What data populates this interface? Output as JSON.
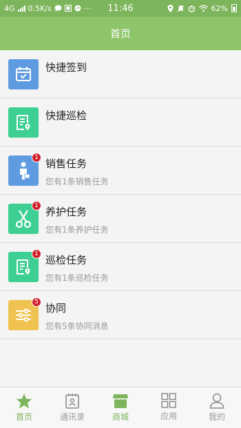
{
  "status_bar": {
    "network": "4G",
    "speed": "0.5K/s",
    "more": "···",
    "time": "11:46",
    "battery": "62%"
  },
  "header": {
    "title": "首页"
  },
  "list": {
    "items": [
      {
        "title": "快捷签到",
        "subtitle": "",
        "badge": "",
        "icon": "calendar-check-icon",
        "color": "#5f9be0"
      },
      {
        "title": "快捷巡检",
        "subtitle": "",
        "badge": "",
        "icon": "document-location-icon",
        "color": "#3ecf92"
      },
      {
        "title": "销售任务",
        "subtitle": "您有1条销售任务",
        "badge": "1",
        "icon": "salesperson-icon",
        "color": "#5f9be0"
      },
      {
        "title": "养护任务",
        "subtitle": "您有1条养护任务",
        "badge": "1",
        "icon": "scissors-icon",
        "color": "#3ecf92"
      },
      {
        "title": "巡检任务",
        "subtitle": "您有1条巡检任务",
        "badge": "1",
        "icon": "document-location-icon",
        "color": "#3ecf92"
      },
      {
        "title": "协同",
        "subtitle": "您有5条协同消息",
        "badge": "5",
        "icon": "sliders-icon",
        "color": "#f0c24f"
      }
    ]
  },
  "tabs": {
    "items": [
      {
        "label": "首页",
        "icon": "star-icon",
        "active": true
      },
      {
        "label": "通讯录",
        "icon": "address-book-icon",
        "active": false
      },
      {
        "label": "商城",
        "icon": "shop-icon",
        "active": true
      },
      {
        "label": "应用",
        "icon": "grid-icon",
        "active": false
      },
      {
        "label": "我的",
        "icon": "person-icon",
        "active": false
      }
    ]
  },
  "colors": {
    "accent": "#7cb55b",
    "header": "#8ec46a",
    "badge": "#d0202a"
  }
}
